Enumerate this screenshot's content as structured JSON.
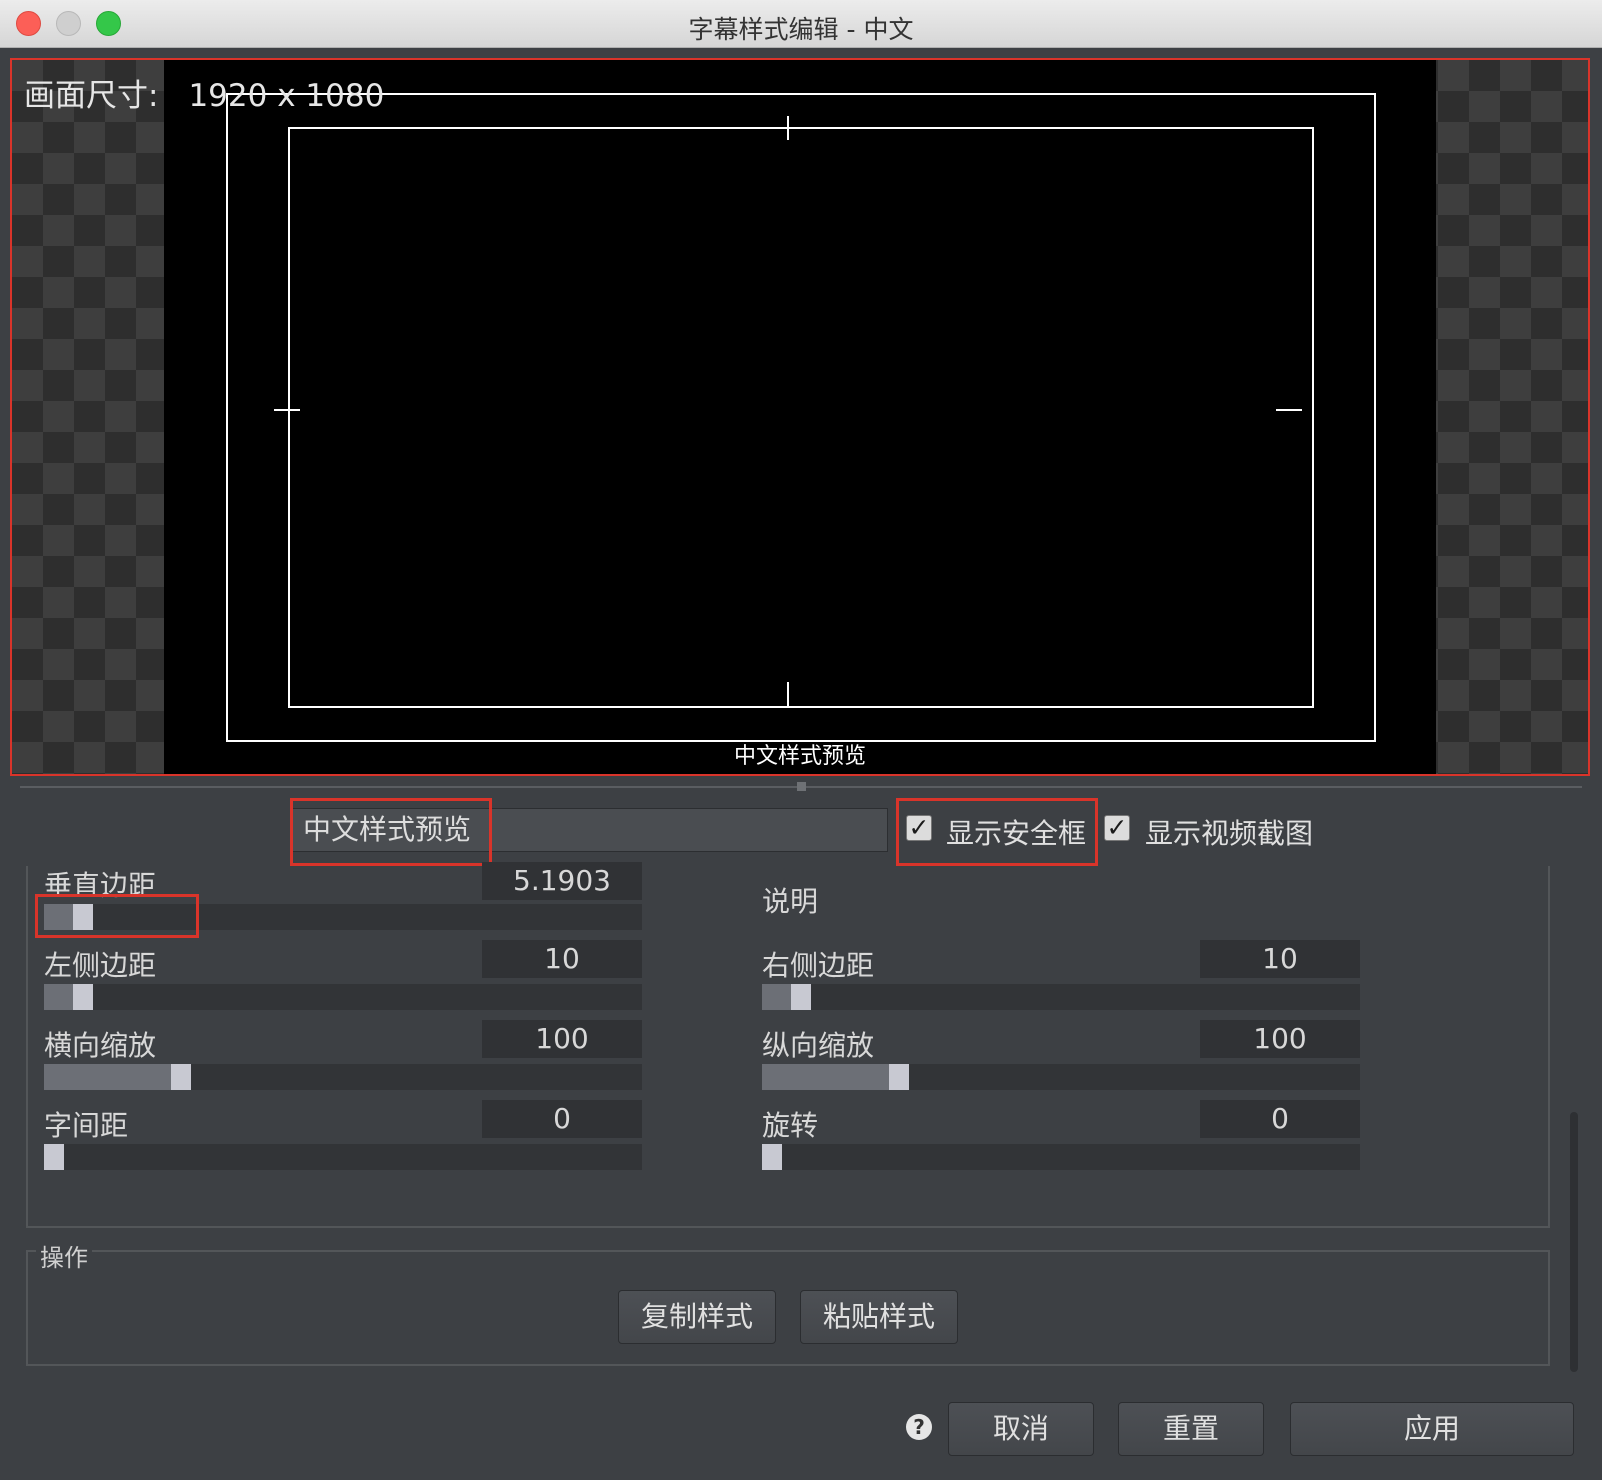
{
  "window": {
    "title": "字幕样式编辑 - 中文"
  },
  "preview": {
    "size_label": "画面尺寸:",
    "size_value": "1920 x 1080",
    "caption": "中文样式预览"
  },
  "controls": {
    "preview_text": "中文样式预览",
    "show_safe_frame": {
      "label": "显示安全框",
      "checked": true
    },
    "show_video_snapshot": {
      "label": "显示视频截图",
      "checked": true
    }
  },
  "params": {
    "vertical_margin": {
      "label": "垂直边距",
      "value": "5.1903",
      "level": 0.05
    },
    "description": {
      "label": "说明"
    },
    "left_margin": {
      "label": "左侧边距",
      "value": "10",
      "level": 0.05
    },
    "right_margin": {
      "label": "右侧边距",
      "value": "10",
      "level": 0.05
    },
    "h_scale": {
      "label": "横向缩放",
      "value": "100",
      "level": 0.22
    },
    "v_scale": {
      "label": "纵向缩放",
      "value": "100",
      "level": 0.22
    },
    "spacing": {
      "label": "字间距",
      "value": "0",
      "level": 0.0
    },
    "rotation": {
      "label": "旋转",
      "value": "0",
      "level": 0.0
    }
  },
  "operations": {
    "legend": "操作",
    "copy_style": "复制样式",
    "paste_style": "粘贴样式"
  },
  "footer": {
    "help_icon": "question-circle-icon",
    "cancel": "取消",
    "reset": "重置",
    "apply": "应用"
  },
  "colors": {
    "highlight": "#d9342a",
    "background": "#3d4044"
  }
}
